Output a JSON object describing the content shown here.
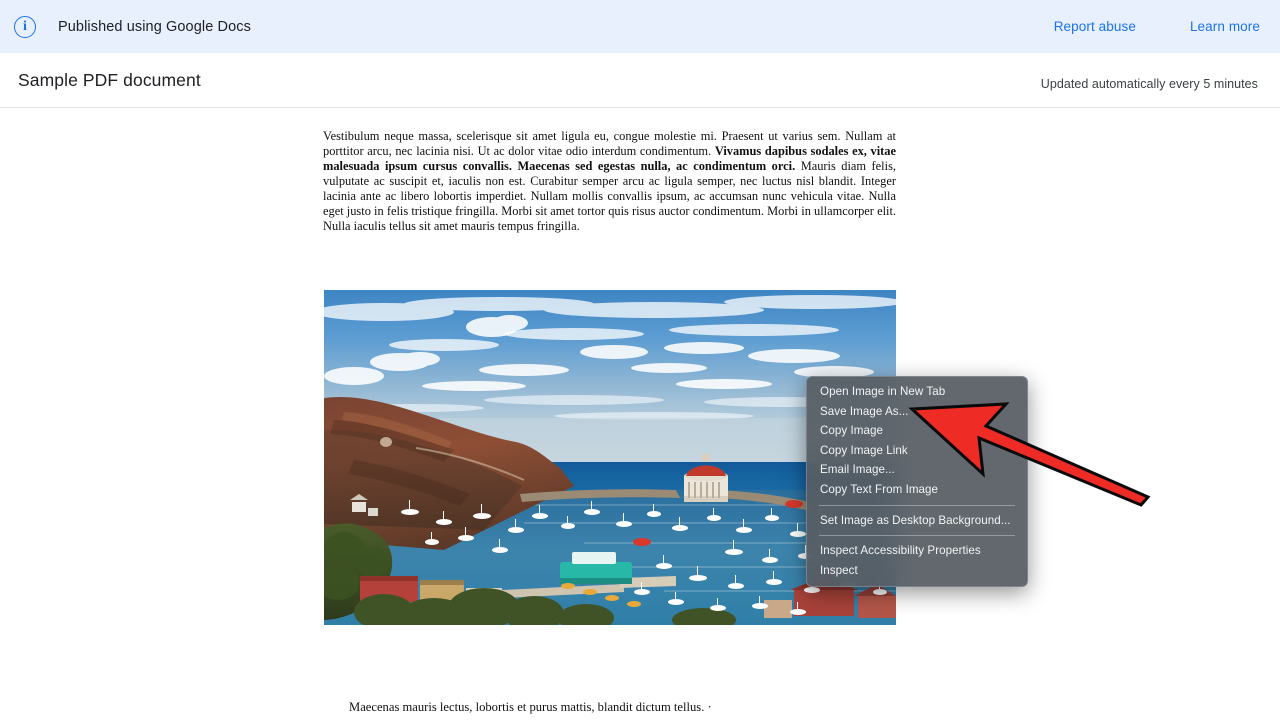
{
  "banner": {
    "icon": "info-circle-icon",
    "text": "Published using Google Docs",
    "links": [
      {
        "label": "Report abuse"
      },
      {
        "label": "Learn more"
      }
    ],
    "background_color": "#e8f0fe",
    "link_color": "#1a73e8"
  },
  "header": {
    "title": "Sample PDF document",
    "update_note": "Updated automatically every 5 minutes"
  },
  "document": {
    "paragraph": {
      "part1": "Vestibulum neque massa, scelerisque sit amet ligula eu, congue molestie mi. Praesent ut varius sem. Nullam at porttitor arcu, nec lacinia nisi. Ut ac dolor vitae odio interdum condimentum. ",
      "bold": "Vivamus dapibus sodales ex, vitae malesuada ipsum cursus convallis. Maecenas sed egestas nulla, ac condimentum orci.",
      "part2": " Mauris diam felis, vulputate ac suscipit et, iaculis non est. Curabitur semper arcu ac ligula semper, nec luctus nisl blandit. Integer lacinia ante ac libero lobortis imperdiet. Nullam mollis convallis ipsum, ac accumsan nunc vehicula vitae. Nulla eget justo in felis tristique fringilla. Morbi sit amet tortor quis risus auctor condimentum. Morbi in ullamcorper elit. Nulla iaculis tellus sit amet mauris tempus fringilla."
    },
    "caption": "Maecenas mauris lectus, lobortis et purus mattis, blandit dictum tellus. ·",
    "image": {
      "name": "catalina-harbor-photo",
      "alt": "Aerial view of Avalon harbor on Catalina Island with boats, casino building and hillside"
    }
  },
  "context_menu": {
    "items": [
      {
        "label": "Open Image in New Tab",
        "type": "item"
      },
      {
        "label": "Save Image As...",
        "type": "item"
      },
      {
        "label": "Copy Image",
        "type": "item"
      },
      {
        "label": "Copy Image Link",
        "type": "item"
      },
      {
        "label": "Email Image...",
        "type": "item"
      },
      {
        "label": "Copy Text From Image",
        "type": "item"
      },
      {
        "label": "",
        "type": "separator"
      },
      {
        "label": "Set Image as Desktop Background...",
        "type": "item"
      },
      {
        "label": "",
        "type": "separator"
      },
      {
        "label": "Inspect Accessibility Properties",
        "type": "item"
      },
      {
        "label": "Inspect",
        "type": "item"
      }
    ]
  },
  "annotation": {
    "name": "red-arrow-pointing-to-save-image-as",
    "color": "#ee2b24",
    "outline_color": "#0a0a0a"
  }
}
